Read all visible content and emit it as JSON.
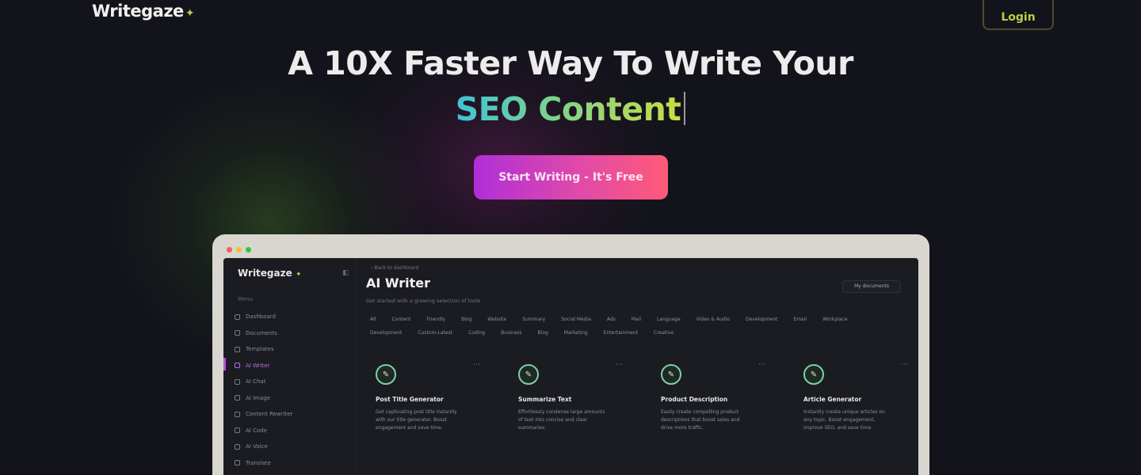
{
  "brand": {
    "name": "Writegaze",
    "mark": "✦"
  },
  "nav": {
    "login_label": "Login"
  },
  "hero": {
    "line1": "A 10X Faster Way To Write Your",
    "line2": "SEO Content",
    "cta_label": "Start Writing - It's Free"
  },
  "colors": {
    "background": "#13141b",
    "accent_green": "#b9d23c",
    "cta_start": "#b02ed8",
    "cta_end": "#ff5a78"
  },
  "app": {
    "logo": "Writegaze",
    "breadcrumb": "‹ Back to dashboard",
    "title": "AI Writer",
    "subtitle": "Get started with a growing selection of tools",
    "top_button": "My documents",
    "menu_section": "Menu",
    "menu": [
      {
        "label": "Dashboard",
        "icon": "grid-icon"
      },
      {
        "label": "Documents",
        "icon": "document-icon"
      },
      {
        "label": "Templates",
        "icon": "template-icon"
      },
      {
        "label": "AI Writer",
        "icon": "pen-icon",
        "active": true
      },
      {
        "label": "AI Chat",
        "icon": "chat-icon"
      },
      {
        "label": "AI Image",
        "icon": "image-icon"
      },
      {
        "label": "Content Rewriter",
        "icon": "refresh-icon"
      },
      {
        "label": "AI Code",
        "icon": "code-icon"
      },
      {
        "label": "AI Voice",
        "icon": "mic-icon"
      },
      {
        "label": "Translate",
        "icon": "translate-icon"
      }
    ],
    "filters": [
      "All",
      "Content",
      "Friendly",
      "Blog",
      "Website",
      "Summary",
      "Social Media",
      "Ads",
      "Mail",
      "Language",
      "Video & Audio",
      "Development",
      "Email",
      "Workplace",
      "Development",
      "Custom-Latest",
      "Coding",
      "Business",
      "Blog",
      "Marketing",
      "Entertainment",
      "Creative"
    ],
    "cards": [
      {
        "title": "Post Title Generator",
        "desc": "Get captivating post title instantly with our title generator. Boost engagement and save time."
      },
      {
        "title": "Summarize Text",
        "desc": "Effortlessly condense large amounts of text into concise and clear summaries."
      },
      {
        "title": "Product Description",
        "desc": "Easily create compelling product descriptions that boost sales and drive more traffic."
      },
      {
        "title": "Article Generator",
        "desc": "Instantly create unique articles on any topic. Boost engagement, improve SEO, and save time."
      }
    ]
  }
}
